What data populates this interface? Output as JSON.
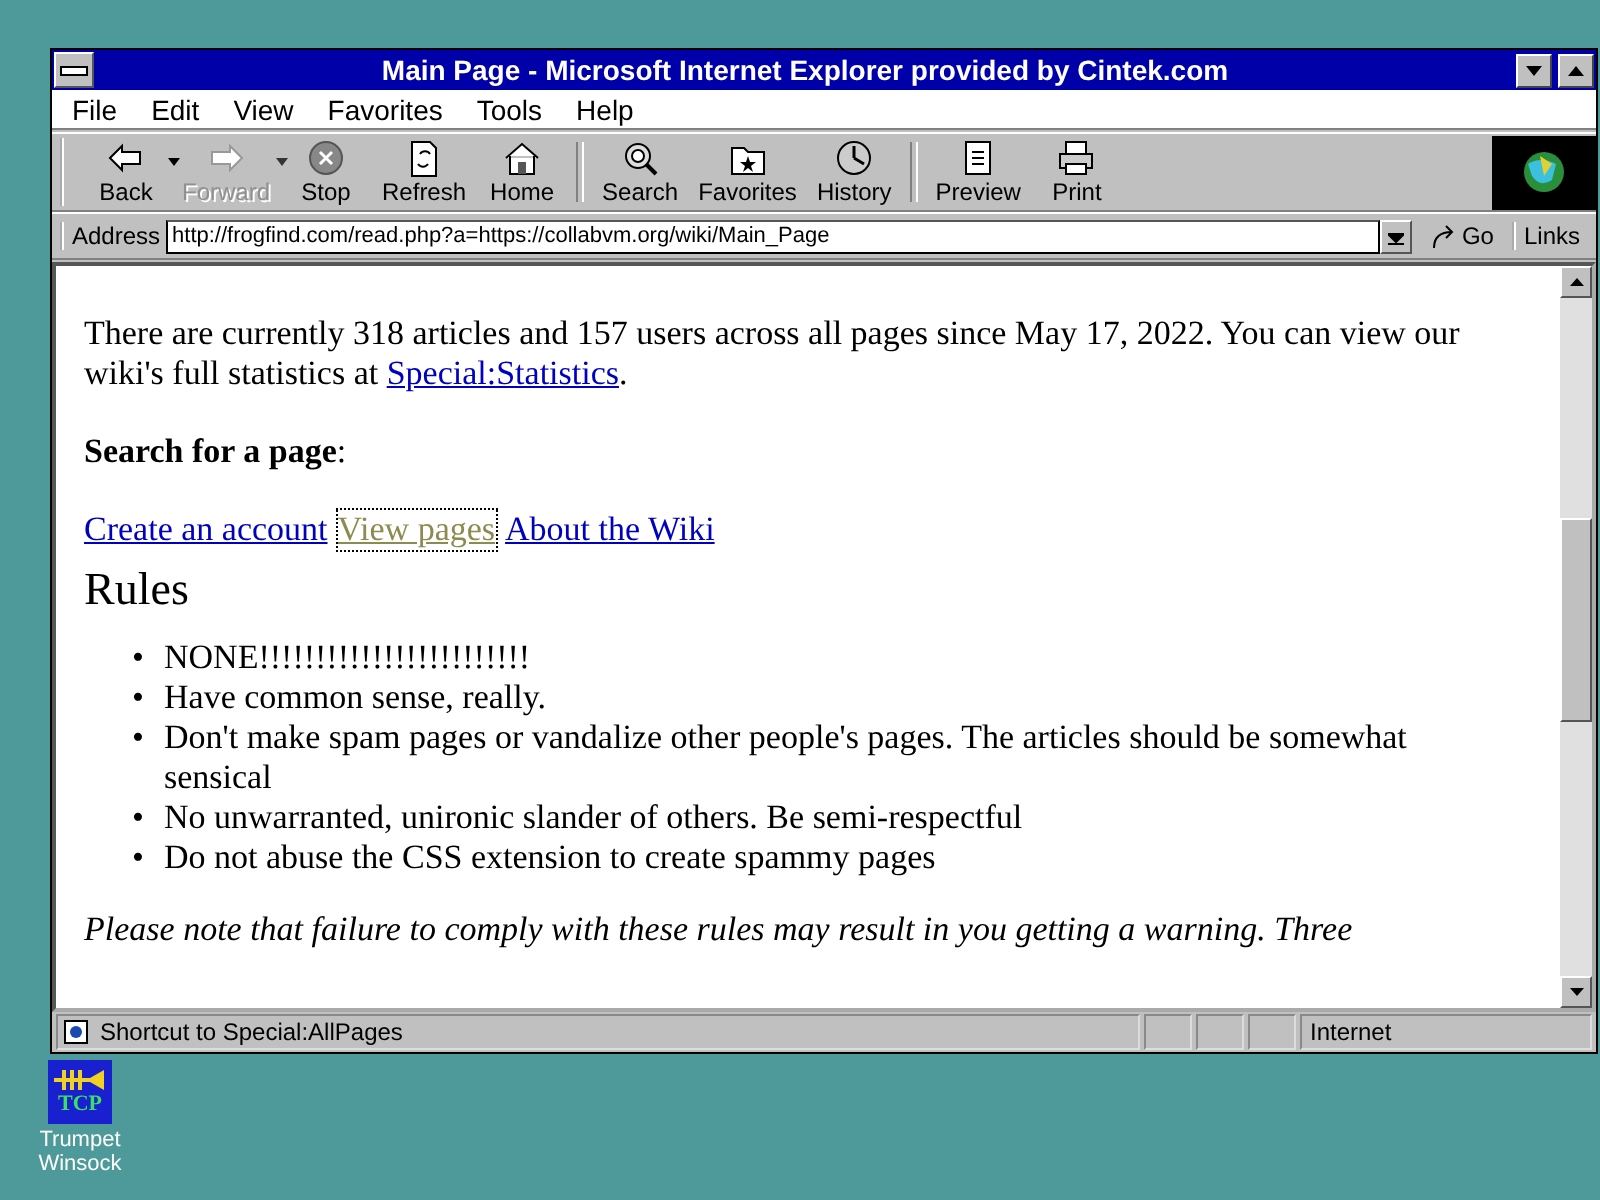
{
  "window": {
    "title": "Main Page - Microsoft Internet Explorer provided by Cintek.com"
  },
  "menu": [
    {
      "label": "File"
    },
    {
      "label": "Edit"
    },
    {
      "label": "View"
    },
    {
      "label": "Favorites"
    },
    {
      "label": "Tools"
    },
    {
      "label": "Help"
    }
  ],
  "toolbar": [
    {
      "label": "Back",
      "kind": "back",
      "disabled": false,
      "dropdown": true
    },
    {
      "label": "Forward",
      "kind": "forward",
      "disabled": true,
      "dropdown": true
    },
    {
      "label": "Stop",
      "kind": "stop",
      "disabled": false,
      "dropdown": false
    },
    {
      "label": "Refresh",
      "kind": "refresh",
      "disabled": false,
      "dropdown": false
    },
    {
      "label": "Home",
      "kind": "home",
      "disabled": false,
      "dropdown": false
    },
    {
      "label": "Search",
      "kind": "search",
      "disabled": false,
      "dropdown": false
    },
    {
      "label": "Favorites",
      "kind": "favorites",
      "disabled": false,
      "dropdown": false
    },
    {
      "label": "History",
      "kind": "history",
      "disabled": false,
      "dropdown": false
    },
    {
      "label": "Preview",
      "kind": "preview",
      "disabled": false,
      "dropdown": false
    },
    {
      "label": "Print",
      "kind": "print",
      "disabled": false,
      "dropdown": false
    }
  ],
  "address": {
    "label": "Address",
    "value": "http://frogfind.com/read.php?a=https://collabvm.org/wiki/Main_Page",
    "go": "Go",
    "links": "Links"
  },
  "page": {
    "intro": "There are currently 318 articles and 157 users across all pages since May 17, 2022. You can view our wiki's full statistics at ",
    "intro_link": "Special:Statistics",
    "intro_end": ".",
    "search_label": "**Search for a page**:",
    "links": [
      {
        "label": "Create an account",
        "visited": false
      },
      {
        "label": "View pages",
        "visited": true
      },
      {
        "label": "About the Wiki",
        "visited": false
      }
    ],
    "heading": "Rules",
    "rules": [
      {
        "marker": "•",
        "text": "NONE!!!!!!!!!!!!!!!!!!!!!!!!"
      },
      {
        "marker": "•",
        "text": "Have common sense, really."
      },
      {
        "marker": "•",
        "text": "Don't make spam pages or vandalize other people's pages. The articles should be somewhat sensical"
      },
      {
        "marker": "•",
        "text": "No unwarranted, unironic slander of others. Be semi-respectful"
      },
      {
        "marker": "•",
        "text": "Do not abuse the CSS extension to create spammy pages"
      }
    ],
    "note": "Please note that failure to comply with these rules may result in you getting a warning. Three"
  },
  "status_bar": {
    "text": "Shortcut to Special:AllPages",
    "zone": "Internet"
  },
  "desktop_icon": {
    "badge": "TCP",
    "label": "Trumpet Winsock"
  }
}
